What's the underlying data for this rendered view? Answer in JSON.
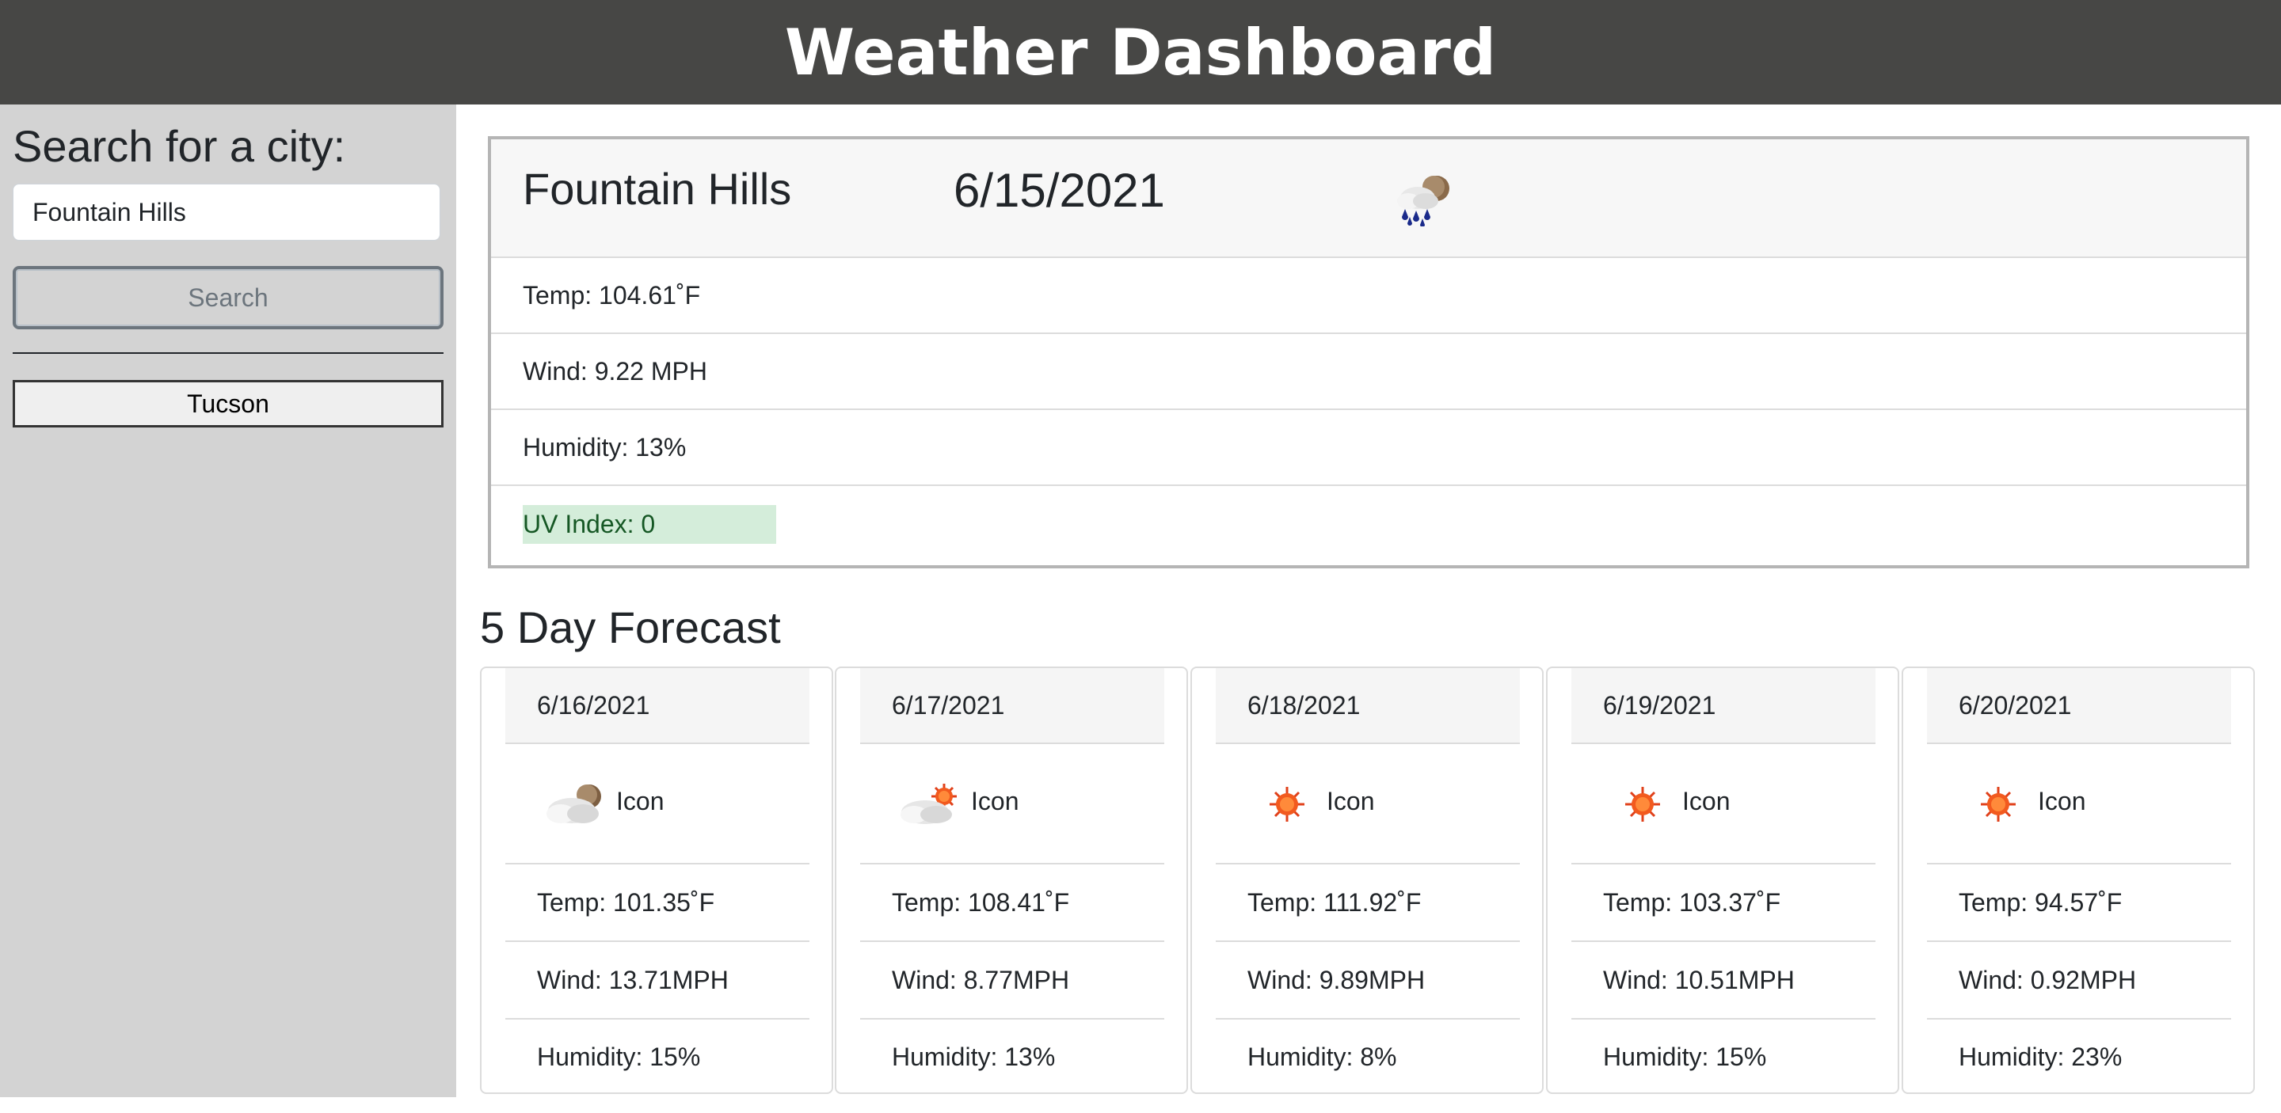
{
  "header": {
    "title": "Weather Dashboard"
  },
  "sidebar": {
    "heading": "Search for a city:",
    "search_value": "Fountain Hills",
    "search_button": "Search",
    "history": [
      "Tucson"
    ]
  },
  "current": {
    "city": "Fountain Hills",
    "date": "6/15/2021",
    "icon": "rain-cloud-moon-icon",
    "temp": "Temp: 104.61˚F",
    "wind": "Wind: 9.22 MPH",
    "humidity": "Humidity: 13%",
    "uv": "UV Index: 0"
  },
  "forecast": {
    "title": "5 Day Forecast",
    "days": [
      {
        "date": "6/16/2021",
        "icon": "cloud-moon-icon",
        "icon_label": "Icon",
        "temp": "Temp: 101.35˚F",
        "wind": "Wind: 13.71MPH",
        "humidity": "Humidity: 15%"
      },
      {
        "date": "6/17/2021",
        "icon": "cloud-sun-icon",
        "icon_label": "Icon",
        "temp": "Temp: 108.41˚F",
        "wind": "Wind: 8.77MPH",
        "humidity": "Humidity: 13%"
      },
      {
        "date": "6/18/2021",
        "icon": "sun-icon",
        "icon_label": "Icon",
        "temp": "Temp: 111.92˚F",
        "wind": "Wind: 9.89MPH",
        "humidity": "Humidity: 8%"
      },
      {
        "date": "6/19/2021",
        "icon": "sun-icon",
        "icon_label": "Icon",
        "temp": "Temp: 103.37˚F",
        "wind": "Wind: 10.51MPH",
        "humidity": "Humidity: 15%"
      },
      {
        "date": "6/20/2021",
        "icon": "sun-icon",
        "icon_label": "Icon",
        "temp": "Temp: 94.57˚F",
        "wind": "Wind: 0.92MPH",
        "humidity": "Humidity: 23%"
      }
    ]
  },
  "colors": {
    "header_bg": "#474745",
    "sidebar_bg": "#d3d3d3",
    "uv_bg": "#d4edda",
    "uv_text": "#155724"
  }
}
